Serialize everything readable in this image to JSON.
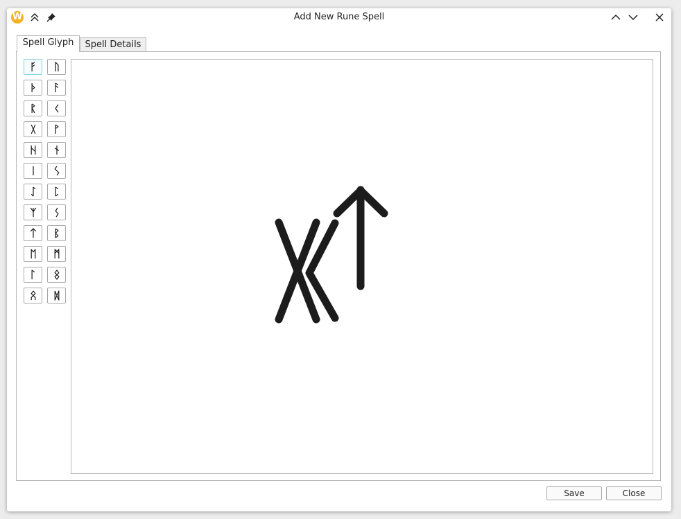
{
  "window": {
    "title": "Add New Rune Spell",
    "app_icon_letter": "W"
  },
  "tabs": [
    {
      "label": "Spell Glyph",
      "active": true
    },
    {
      "label": "Spell Details",
      "active": false
    }
  ],
  "rune_palette": [
    {
      "name": "fehu",
      "glyph": "ᚠ",
      "selected": true
    },
    {
      "name": "uruz",
      "glyph": "ᚢ"
    },
    {
      "name": "thurisaz",
      "glyph": "ᚦ"
    },
    {
      "name": "ansuz",
      "glyph": "ᚨ"
    },
    {
      "name": "raido",
      "glyph": "ᚱ"
    },
    {
      "name": "kaunan",
      "glyph": "ᚲ"
    },
    {
      "name": "gebo",
      "glyph": "ᚷ"
    },
    {
      "name": "wunjo",
      "glyph": "ᚹ"
    },
    {
      "name": "hagalaz",
      "glyph": "ᚺ"
    },
    {
      "name": "naudiz",
      "glyph": "ᚾ"
    },
    {
      "name": "isaz",
      "glyph": "ᛁ"
    },
    {
      "name": "jera",
      "glyph": "ᛃ"
    },
    {
      "name": "eihwaz",
      "glyph": "ᛇ"
    },
    {
      "name": "perth",
      "glyph": "ᛈ"
    },
    {
      "name": "algiz",
      "glyph": "ᛉ"
    },
    {
      "name": "sowilo",
      "glyph": "ᛊ"
    },
    {
      "name": "tiwaz",
      "glyph": "ᛏ"
    },
    {
      "name": "berkanan",
      "glyph": "ᛒ"
    },
    {
      "name": "ehwaz",
      "glyph": "ᛖ"
    },
    {
      "name": "mannaz",
      "glyph": "ᛗ"
    },
    {
      "name": "laguz",
      "glyph": "ᛚ"
    },
    {
      "name": "ingwaz",
      "glyph": "ᛜ"
    },
    {
      "name": "othala",
      "glyph": "ᛟ"
    },
    {
      "name": "dagaz",
      "glyph": "ᛞ"
    }
  ],
  "composed_spell": [
    "gebo",
    "kaunan",
    "tiwaz"
  ],
  "footer": {
    "save_label": "Save",
    "close_label": "Close"
  }
}
